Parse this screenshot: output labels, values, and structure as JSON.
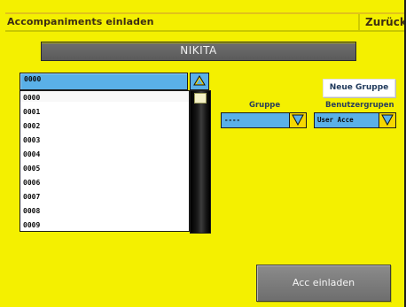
{
  "header": {
    "title": "Accompaniments einladen",
    "back_label": "Zurück"
  },
  "banner": {
    "name": "NIKITA"
  },
  "list": {
    "selected_value": "0000",
    "items": [
      "0000",
      "0001",
      "0002",
      "0003",
      "0004",
      "0005",
      "0006",
      "0007",
      "0008",
      "0009"
    ]
  },
  "group": {
    "label": "Gruppe",
    "value": "----"
  },
  "user_groups": {
    "label": "Benutzergrupen",
    "value": "User Acce"
  },
  "buttons": {
    "new_group": "Neue Gruppe",
    "invite": "Acc einladen"
  },
  "colors": {
    "background": "#f4f000",
    "field_blue": "#5ab0e8",
    "button_gray": "#777777"
  },
  "icons": {
    "scroll_up": "triangle-up-icon",
    "dropdown": "triangle-down-icon"
  }
}
